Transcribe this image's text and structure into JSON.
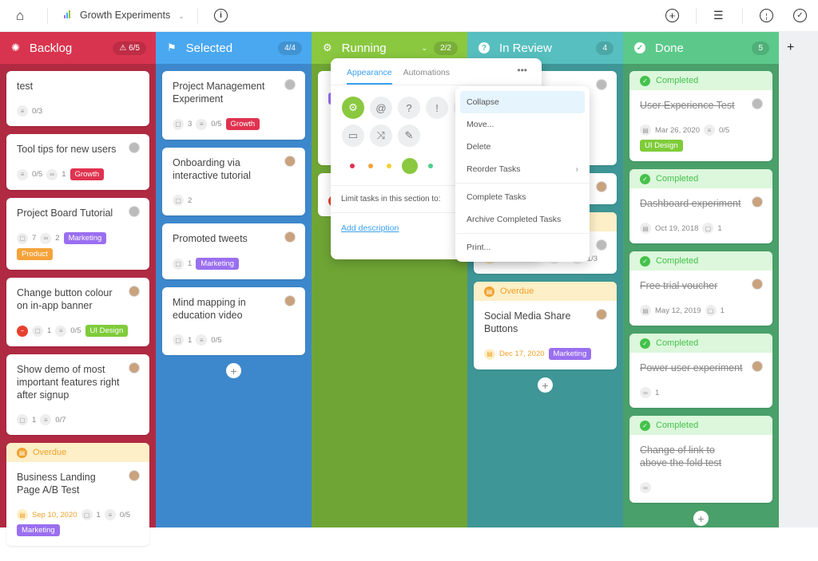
{
  "topbar": {
    "project_name": "Growth Experiments",
    "icons": [
      "home-icon",
      "bar-chart-icon",
      "chevron-down-icon",
      "info-icon",
      "add-circle-icon",
      "timeline-icon",
      "stopwatch-icon",
      "check-circle-icon"
    ]
  },
  "colors": {
    "tag_growth": "#e0334f",
    "tag_marketing": "#9a6ff0",
    "tag_product": "#f5a33a",
    "tag_ui": "#7fcc3a",
    "overdue": "#f0a12a",
    "completed": "#44c24a"
  },
  "columns": [
    {
      "name": "Backlog",
      "icon": "lightbulb-icon",
      "count": "6/5",
      "warn": true,
      "head": "#d9344f",
      "bg": "#b02a42",
      "cards": [
        {
          "title": "test",
          "meta": [
            {
              "i": "checklist",
              "v": "0/3"
            }
          ]
        },
        {
          "title": "Tool tips for new users",
          "av": "g",
          "meta": [
            {
              "i": "checklist",
              "v": "0/5"
            },
            {
              "i": "attachment",
              "v": "1"
            }
          ],
          "tags": [
            "Growth"
          ]
        },
        {
          "title": "Project Board Tutorial",
          "av": "g",
          "meta": [
            {
              "i": "comment",
              "v": "7"
            },
            {
              "i": "attachment",
              "v": "2"
            }
          ],
          "tags": [
            "Marketing",
            "Product"
          ]
        },
        {
          "title": "Change button colour on in-app banner",
          "av": "c",
          "blocked": true,
          "meta": [
            {
              "i": "comment",
              "v": "1"
            },
            {
              "i": "checklist",
              "v": "0/5"
            }
          ],
          "tags": [
            "UI Design"
          ]
        },
        {
          "title": "Show demo of most important features right after signup",
          "av": "c",
          "meta": [
            {
              "i": "comment",
              "v": "1"
            },
            {
              "i": "checklist",
              "v": "0/7"
            }
          ]
        },
        {
          "band": "Overdue",
          "title": "Business Landing Page A/B Test",
          "av": "c",
          "date": "Sep 10, 2020",
          "meta": [
            {
              "i": "comment",
              "v": "1"
            },
            {
              "i": "checklist",
              "v": "0/5"
            }
          ],
          "tags": [
            "Marketing"
          ]
        }
      ]
    },
    {
      "name": "Selected",
      "icon": "signpost-icon",
      "count": "4/4",
      "head": "#4aa8f0",
      "bg": "#3d88cc",
      "add": true,
      "cards": [
        {
          "title": "Project Management Experiment",
          "av": "g",
          "meta": [
            {
              "i": "comment",
              "v": "3"
            },
            {
              "i": "checklist",
              "v": "0/5"
            }
          ],
          "tags": [
            "Growth"
          ]
        },
        {
          "title": "Onboarding via interactive tutorial",
          "av": "c",
          "meta": [
            {
              "i": "comment",
              "v": "2"
            }
          ]
        },
        {
          "title": "Promoted tweets",
          "av": "c",
          "meta": [
            {
              "i": "comment",
              "v": "1"
            }
          ],
          "tags": [
            "Marketing"
          ]
        },
        {
          "title": "Mind mapping in education video",
          "av": "c",
          "meta": [
            {
              "i": "comment",
              "v": "1"
            },
            {
              "i": "checklist",
              "v": "0/5"
            }
          ]
        }
      ]
    },
    {
      "name": "Running",
      "icon": "gear-icon",
      "count": "2/2",
      "chev": true,
      "head": "#8ac840",
      "bg": "#6fa535",
      "cards": [
        {
          "title": "",
          "meta": [],
          "tags": [
            "Marketing"
          ],
          "tall": true
        },
        {
          "title": "",
          "blocked": true,
          "meta": [],
          "tags": [
            "Marketing"
          ]
        }
      ]
    },
    {
      "name": "In Review",
      "icon": "question-icon",
      "count": "4",
      "head": "#57bfbf",
      "bg": "#3f9696",
      "add": true,
      "cards": [
        {
          "title": "",
          "av": "g",
          "meta": [],
          "tall": true
        },
        {
          "title": "",
          "av": "c",
          "meta": []
        },
        {
          "band": "Overdue",
          "title": "",
          "av": "g",
          "date": "Nov 19, 2020",
          "meta": [
            {
              "i": "comment",
              "v": "2"
            },
            {
              "i": "checklist",
              "v": "1/3"
            }
          ]
        },
        {
          "band": "Overdue",
          "title": "Social Media Share Buttons",
          "av": "c",
          "date": "Dec 17, 2020",
          "meta": [],
          "tags": [
            "Marketing"
          ]
        }
      ]
    },
    {
      "name": "Done",
      "icon": "check-circle-icon",
      "count": "5",
      "head": "#5cc98a",
      "bg": "#4aa06a",
      "add": true,
      "cards": [
        {
          "band": "Completed",
          "title": "User Experience Test",
          "strike": true,
          "av": "g",
          "date": "Mar 26, 2020",
          "meta": [
            {
              "i": "checklist",
              "v": "0/5"
            }
          ],
          "tags": [
            "UI Design"
          ]
        },
        {
          "band": "Completed",
          "title": "Dashboard experiment",
          "strike": true,
          "av": "c",
          "date": "Oct 19, 2018",
          "meta": [
            {
              "i": "comment",
              "v": "1"
            }
          ]
        },
        {
          "band": "Completed",
          "title": "Free trial voucher",
          "strike": true,
          "av": "c",
          "date": "May 12, 2019",
          "meta": [
            {
              "i": "comment",
              "v": "1"
            }
          ]
        },
        {
          "band": "Completed",
          "title": "Power user experiment",
          "strike": true,
          "av": "c",
          "meta": [
            {
              "i": "attachment",
              "v": "1"
            }
          ]
        },
        {
          "band": "Completed",
          "title": "Change of link to above the fold test",
          "strike": true,
          "meta": [
            {
              "i": "attachment",
              "v": ""
            }
          ]
        }
      ]
    }
  ],
  "popup": {
    "tabs": [
      "Appearance",
      "Automations"
    ],
    "active_tab": "Appearance",
    "icons": [
      "gear-icon",
      "at-icon",
      "question-icon",
      "exclamation-icon",
      "music-icon",
      "tv-icon",
      "shuffle-icon",
      "brush-icon"
    ],
    "colors": [
      "#e0334f",
      "#f5a33a",
      "#f5d030",
      "#8ac840",
      "#4cd08a"
    ],
    "selected_color": "#8ac840",
    "limit_label": "Limit tasks in this section to:",
    "add_description": "Add description"
  },
  "menu": {
    "items": [
      "Collapse",
      "Move...",
      "Delete",
      "Reorder Tasks",
      "Complete Tasks",
      "Archive Completed Tasks",
      "Print..."
    ],
    "highlighted": "Collapse"
  }
}
